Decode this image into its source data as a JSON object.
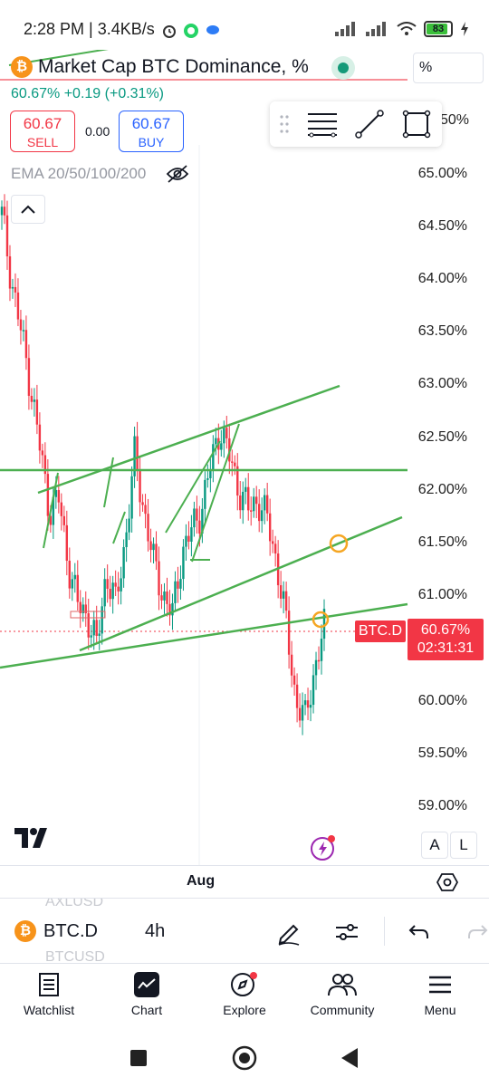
{
  "status_bar": {
    "time": "2:28 PM",
    "network_speed": "3.4KB/s",
    "battery": "83"
  },
  "header": {
    "title": "Market Cap BTC Dominance, %",
    "change": "60.67%  +0.19 (+0.31%)",
    "sell_price": "60.67",
    "sell_label": "SELL",
    "spread": "0.00",
    "buy_price": "60.67",
    "buy_label": "BUY",
    "unit": "%"
  },
  "indicator": {
    "label": "EMA 20/50/100/200"
  },
  "colors": {
    "accent_red": "#f23645",
    "accent_blue": "#2962ff",
    "up_green": "#089981",
    "trendline_green": "#4caf50",
    "marker_orange": "#f5a623"
  },
  "price_scale": {
    "labels": [
      "65.00%",
      "64.50%",
      "64.00%",
      "63.50%",
      "63.00%",
      "62.50%",
      "62.00%",
      "61.50%",
      "61.00%",
      "60.00%",
      "59.50%",
      "59.00%"
    ],
    "top_partial": "50%",
    "current_symbol": "BTC.D",
    "current_price": "60.67%",
    "countdown": "02:31:31"
  },
  "time_axis": {
    "label": "Aug"
  },
  "scale_buttons": {
    "auto": "A",
    "log": "L"
  },
  "symbol_bar": {
    "symbol": "BTC.D",
    "timeframe": "4h",
    "ghost_above": "AXLUSD",
    "ghost_below": "BTCUSD"
  },
  "bottom_nav": [
    {
      "label": "Watchlist",
      "icon": "watchlist-icon"
    },
    {
      "label": "Chart",
      "icon": "chart-icon"
    },
    {
      "label": "Explore",
      "icon": "compass-icon"
    },
    {
      "label": "Community",
      "icon": "community-icon"
    },
    {
      "label": "Menu",
      "icon": "menu-icon"
    }
  ],
  "chart_data": {
    "type": "candlestick",
    "price_range": [
      59.0,
      65.0
    ],
    "x_tick_labels": [
      "Aug"
    ],
    "current_price_line": 60.67,
    "approx_path": [
      64.6,
      64.0,
      63.5,
      63.0,
      62.4,
      61.8,
      61.9,
      61.3,
      60.9,
      60.8,
      60.5,
      61.2,
      60.9,
      61.5,
      62.3,
      61.8,
      61.3,
      61.0,
      60.8,
      61.4,
      61.6,
      61.8,
      62.2,
      62.6,
      62.3,
      62.0,
      61.8,
      61.9,
      61.7,
      61.3,
      60.7,
      60.0,
      59.8,
      60.3,
      60.67
    ]
  }
}
